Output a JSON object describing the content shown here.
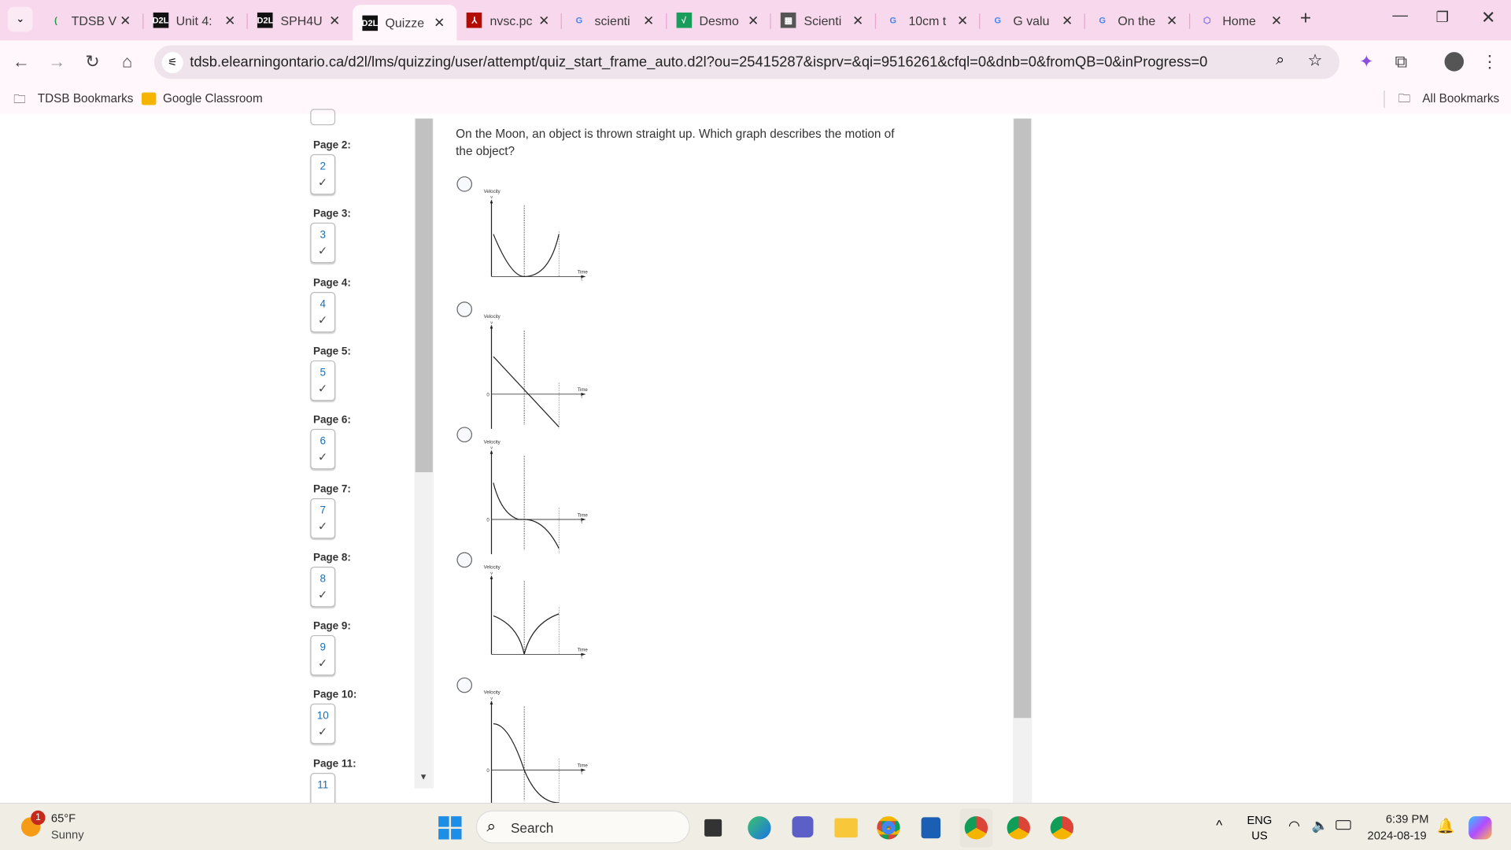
{
  "browser": {
    "tabs": [
      {
        "title": "TDSB V",
        "icon": "tdsb-icon",
        "color": "#1b9e3e"
      },
      {
        "title": "Unit 4:",
        "icon": "d2l-icon",
        "color": "#111111"
      },
      {
        "title": "SPH4U",
        "icon": "d2l-icon",
        "color": "#111111"
      },
      {
        "title": "Quizze",
        "icon": "d2l-icon",
        "color": "#111111",
        "active": true
      },
      {
        "title": "nvsc.pc",
        "icon": "pdf-icon",
        "color": "#b30b00"
      },
      {
        "title": "scienti",
        "icon": "google-icon",
        "color": "#4285f4"
      },
      {
        "title": "Desmo",
        "icon": "desmos-icon",
        "color": "#1a9d5a"
      },
      {
        "title": "Scienti",
        "icon": "calculator-icon",
        "color": "#555555"
      },
      {
        "title": "10cm t",
        "icon": "google-icon",
        "color": "#4285f4"
      },
      {
        "title": "G valu",
        "icon": "google-icon",
        "color": "#4285f4"
      },
      {
        "title": "On the",
        "icon": "google-icon",
        "color": "#4285f4"
      },
      {
        "title": "Home",
        "icon": "gem-icon",
        "color": "#7b6cf0"
      }
    ],
    "url": "tdsb.elearningontario.ca/d2l/lms/quizzing/user/attempt/quiz_start_frame_auto.d2l?ou=25415287&isprv=&qi=9516261&cfql=0&dnb=0&fromQB=0&inProgress=0",
    "bookmarks": [
      "TDSB Bookmarks",
      "Google Classroom"
    ],
    "all_bookmarks": "All Bookmarks"
  },
  "nav": {
    "pages": [
      {
        "label": "Page 2:",
        "num": "2"
      },
      {
        "label": "Page 3:",
        "num": "3"
      },
      {
        "label": "Page 4:",
        "num": "4"
      },
      {
        "label": "Page 5:",
        "num": "5"
      },
      {
        "label": "Page 6:",
        "num": "6"
      },
      {
        "label": "Page 7:",
        "num": "7"
      },
      {
        "label": "Page 8:",
        "num": "8"
      },
      {
        "label": "Page 9:",
        "num": "9"
      },
      {
        "label": "Page 10:",
        "num": "10"
      },
      {
        "label": "Page 11:",
        "num": "11"
      }
    ],
    "check": "✓"
  },
  "question": {
    "text": "On the Moon, an object is thrown straight up. Which graph describes the motion of the object?",
    "graph_labels": {
      "y": "Velocity",
      "yvar": "v",
      "x": "Time",
      "xvar": "t",
      "zero": "0"
    },
    "options": [
      {
        "shape": "u-parabola-positive",
        "has_zero": false
      },
      {
        "shape": "linear-decreasing",
        "has_zero": true
      },
      {
        "shape": "decay-then-negative",
        "has_zero": true
      },
      {
        "shape": "cusp-at-zero",
        "has_zero": false
      },
      {
        "shape": "s-curve-decreasing",
        "has_zero": true
      }
    ]
  },
  "taskbar": {
    "weather_temp": "65°F",
    "weather_desc": "Sunny",
    "weather_badge": "1",
    "search": "Search",
    "lang": "ENG",
    "region": "US",
    "time": "6:39 PM",
    "date": "2024-08-19"
  }
}
